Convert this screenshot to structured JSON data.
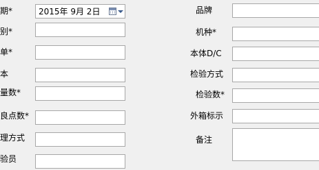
{
  "left": {
    "date_label": "期*",
    "date_value": "2015年  9月  2日",
    "category_label": "别*",
    "order_label": "单*",
    "sample_label": "本",
    "quantity_label": "量数*",
    "defect_label": "良点数*",
    "handling_label": "理方式",
    "inspector_label": "验员"
  },
  "right": {
    "brand_label": "品牌",
    "model_label": "机种*",
    "body_dc_label": "本体D/C",
    "method_label": "检验方式",
    "inspect_count_label": "检验数*",
    "carton_label": "外箱标示",
    "remark_label": "备注"
  },
  "icons": {
    "date_picker": "calendar-icon",
    "dropdown": "chevron-down-icon"
  }
}
